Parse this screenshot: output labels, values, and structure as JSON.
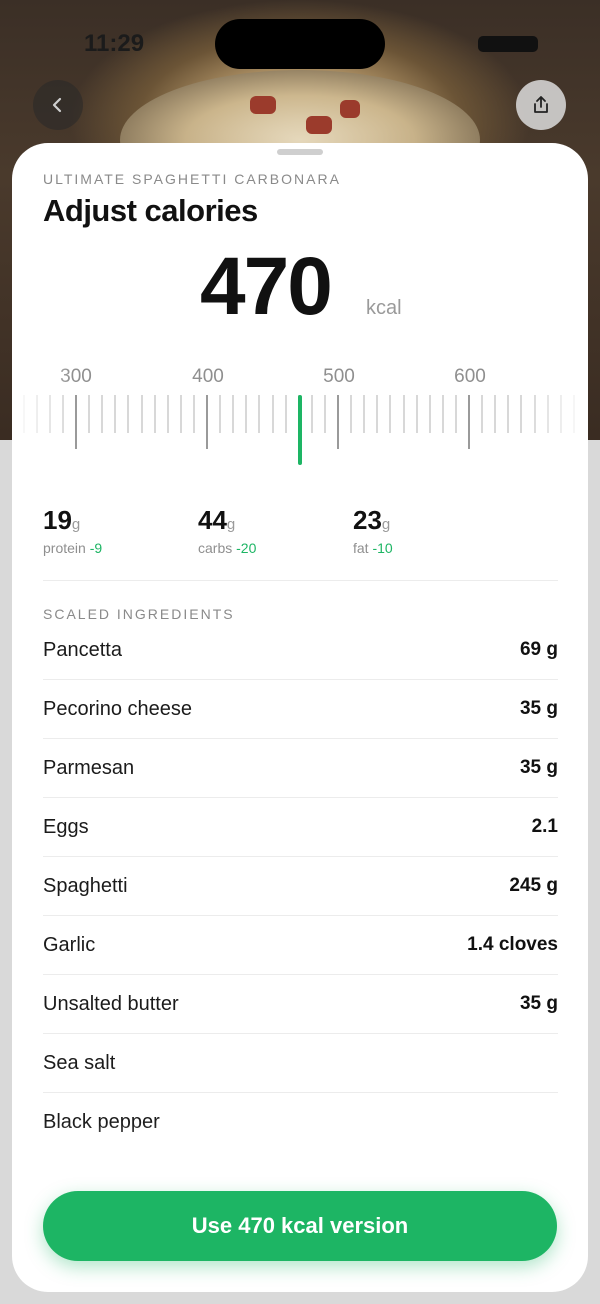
{
  "status_bar": {
    "time": "11:29"
  },
  "header": {
    "back_icon": "chevron-left-icon",
    "share_icon": "share-icon"
  },
  "sheet": {
    "recipe_name": "ULTIMATE SPAGHETTI CARBONARA",
    "title": "Adjust calories",
    "calories": {
      "value": "470",
      "unit": "kcal"
    },
    "ruler": {
      "labels": [
        "300",
        "400",
        "500",
        "600"
      ],
      "selected_value": 470
    },
    "macros": [
      {
        "value": "19",
        "unit": "g",
        "label": "protein",
        "delta": "-9"
      },
      {
        "value": "44",
        "unit": "g",
        "label": "carbs",
        "delta": "-20"
      },
      {
        "value": "23",
        "unit": "g",
        "label": "fat",
        "delta": "-10"
      }
    ],
    "ingredients_header": "SCALED INGREDIENTS",
    "ingredients": [
      {
        "name": "Pancetta",
        "qty": "69 g"
      },
      {
        "name": "Pecorino cheese",
        "qty": "35 g"
      },
      {
        "name": "Parmesan",
        "qty": "35 g"
      },
      {
        "name": "Eggs",
        "qty": "2.1"
      },
      {
        "name": "Spaghetti",
        "qty": "245 g"
      },
      {
        "name": "Garlic",
        "qty": "1.4 cloves"
      },
      {
        "name": "Unsalted butter",
        "qty": "35 g"
      },
      {
        "name": "Sea salt",
        "qty": ""
      },
      {
        "name": "Black pepper",
        "qty": ""
      }
    ],
    "primary_button": "Use 470 kcal version"
  },
  "colors": {
    "accent": "#1db564",
    "text": "#111111",
    "muted": "#8a8a8a"
  }
}
